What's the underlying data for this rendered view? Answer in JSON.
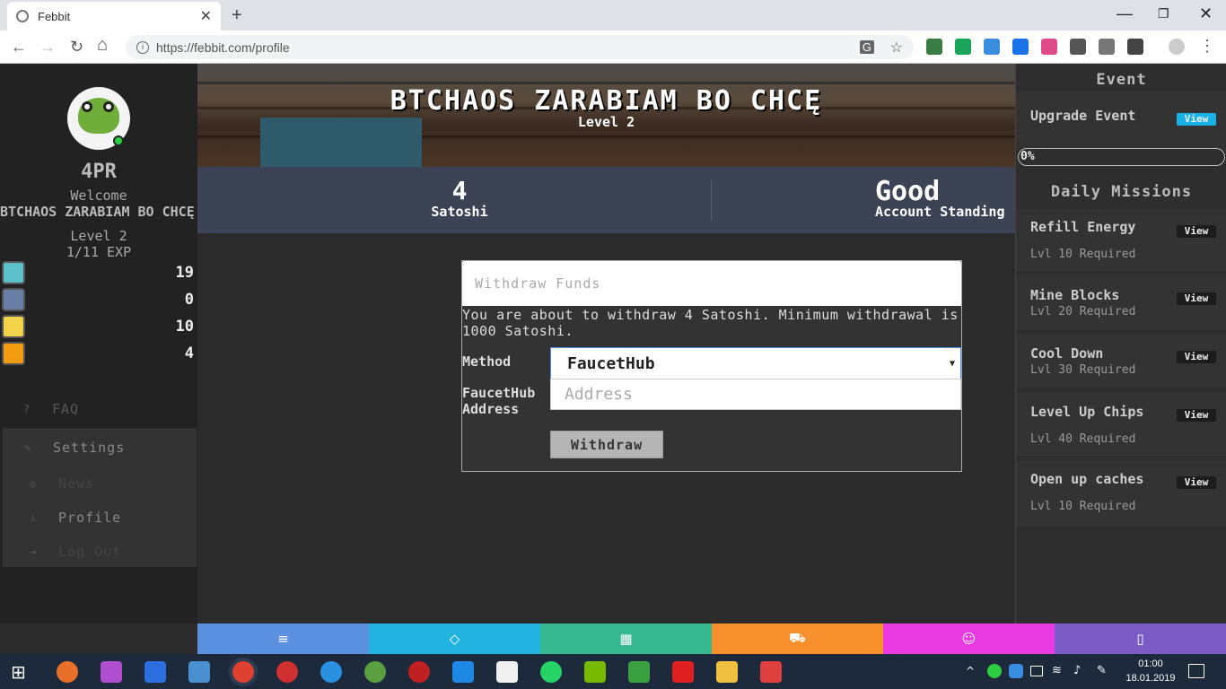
{
  "browser": {
    "tab_title": "Febbit",
    "tab_close": "✕",
    "new_tab": "+",
    "url": "https://febbit.com/profile",
    "info_icon": "i",
    "star_icon": "☆",
    "win_min": "—",
    "win_max": "❐",
    "win_close": "✕"
  },
  "nav": {
    "back": "←",
    "forward": "→",
    "reload": "↻",
    "home": "⌂"
  },
  "user": {
    "name": "4PR",
    "welcome": "Welcome",
    "display_name": "BTCHAOS ZARABIAM BO CHCĘ",
    "level": "Level 2",
    "exp": "1/11 EXP"
  },
  "resources": [
    {
      "icon": "energy-icon",
      "value": "19",
      "color": "#5bc0c9"
    },
    {
      "icon": "mine-cart-icon",
      "value": "0",
      "color": "#6a7fa8"
    },
    {
      "icon": "gem-icon",
      "value": "10",
      "color": "#f2d24a"
    },
    {
      "icon": "bitcoin-icon",
      "value": "4",
      "color": "#f39c12"
    }
  ],
  "menu": {
    "faq": "FAQ",
    "settings": "Settings",
    "news": "News",
    "profile": "Profile",
    "logout": "Log Out"
  },
  "header": {
    "title": "BTCHAOS ZARABIAM BO CHCĘ",
    "level": "Level 2"
  },
  "stats": {
    "satoshi_value": "4",
    "satoshi_label": "Satoshi",
    "standing_value": "Good",
    "standing_label": "Account Standing"
  },
  "withdraw": {
    "title": "Withdraw Funds",
    "message": "You are about to withdraw 4 Satoshi. Minimum withdrawal is 1000 Satoshi.",
    "method_label": "Method",
    "method_value": "FaucetHub",
    "address_label_1": "FaucetHub",
    "address_label_2": "Address",
    "address_placeholder": "Address",
    "button": "Withdraw"
  },
  "event": {
    "heading": "Event",
    "item_title": "Upgrade Event",
    "view": "View",
    "progress": "0%",
    "progress_value": 0
  },
  "missions": {
    "heading": "Daily Missions",
    "items": [
      {
        "title": "Refill Energy",
        "req": "Lvl 10 Required",
        "view": "View"
      },
      {
        "title": "Mine Blocks",
        "req": "Lvl 20 Required",
        "view": "View"
      },
      {
        "title": "Cool Down",
        "req": "Lvl 30 Required",
        "view": "View"
      },
      {
        "title": "Level Up Chips",
        "req": "Lvl 40 Required",
        "view": "View"
      },
      {
        "title": "Open up caches",
        "req": "Lvl 10 Required",
        "view": "View"
      }
    ]
  },
  "bottom_nav": [
    {
      "icon": "menu-icon",
      "glyph": "≡",
      "color": "#5b8fe0"
    },
    {
      "icon": "diamond-icon",
      "glyph": "◇",
      "color": "#22b3e0"
    },
    {
      "icon": "grid-icon",
      "glyph": "▦",
      "color": "#36b890"
    },
    {
      "icon": "cart-icon",
      "glyph": "⛟",
      "color": "#f7902c"
    },
    {
      "icon": "users-icon",
      "glyph": "☺",
      "color": "#e83ae0"
    },
    {
      "icon": "phone-icon",
      "glyph": "▯",
      "color": "#7b5cc6"
    }
  ],
  "taskbar": {
    "time": "01:00",
    "date": "18.01.2019"
  }
}
